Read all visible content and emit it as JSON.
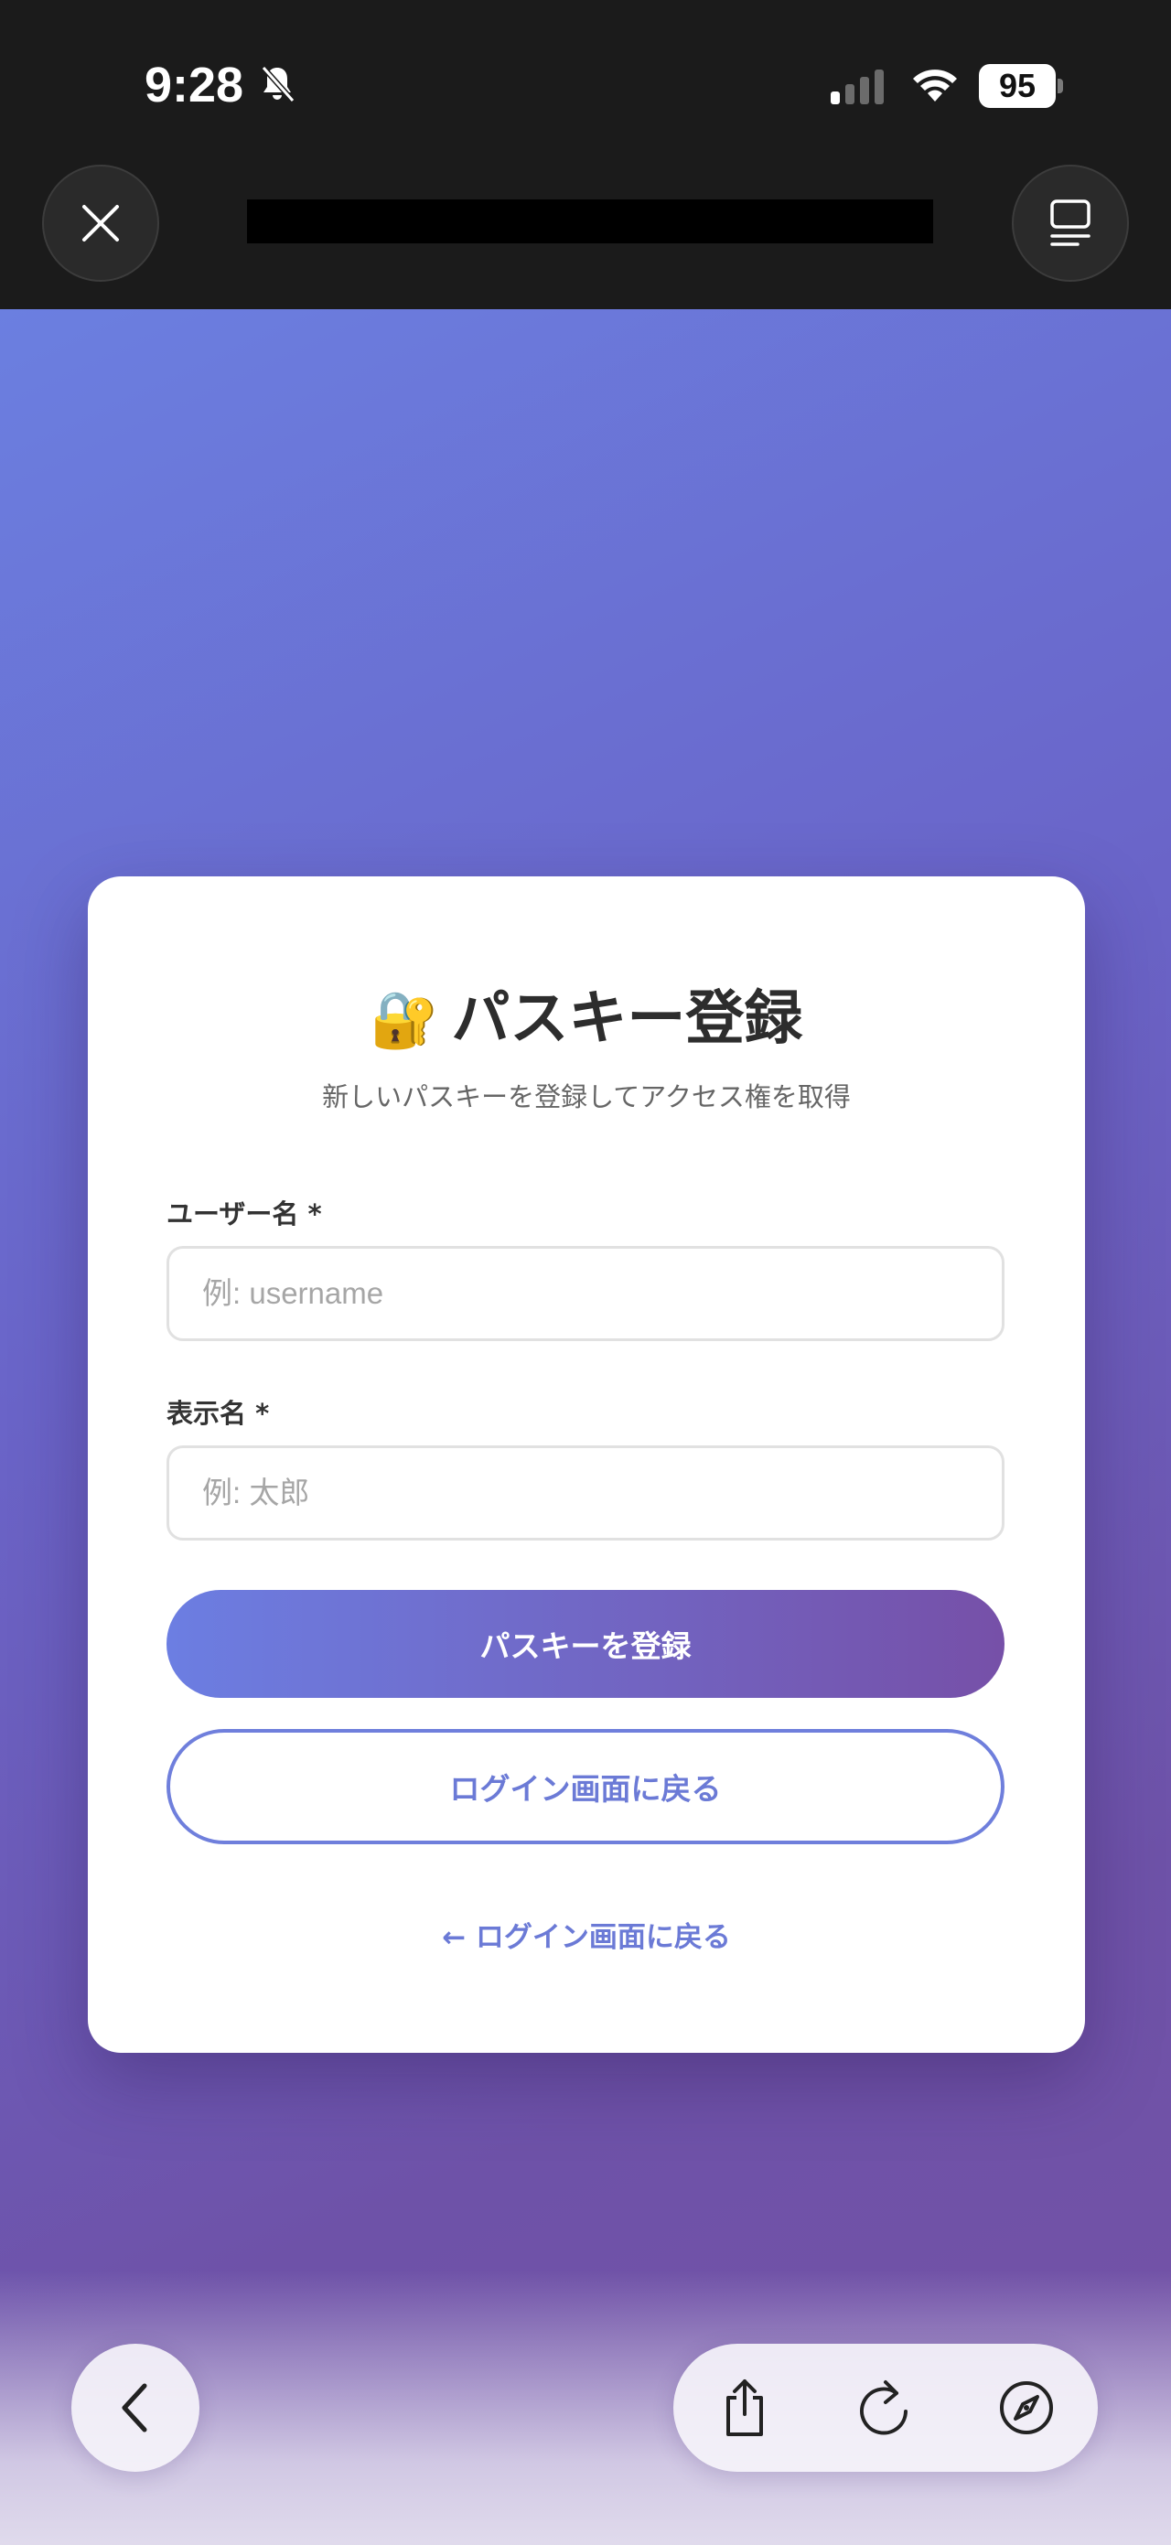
{
  "status_bar": {
    "time": "9:28",
    "battery": "95",
    "icons": [
      "bell-slash-icon",
      "cellular-signal-icon",
      "wifi-icon",
      "battery-icon"
    ]
  },
  "browser": {
    "close_icon": "close-icon",
    "menu_icon": "tab-overview-icon",
    "url_redacted": true
  },
  "card": {
    "emoji": "🔐",
    "title": "パスキー登録",
    "subtitle": "新しいパスキーを登録してアクセス権を取得",
    "username": {
      "label": "ユーザー名 *",
      "placeholder": "例: username",
      "value": ""
    },
    "display_name": {
      "label": "表示名 *",
      "placeholder": "例: 太郎",
      "value": ""
    },
    "register_button": "パスキーを登録",
    "back_button": "ログイン画面に戻る",
    "back_link": "← ログイン画面に戻る"
  },
  "toolbar": {
    "icons": [
      "back-chevron-icon",
      "share-icon",
      "reload-icon",
      "compass-icon"
    ]
  },
  "colors": {
    "accent": "#6b7ad6",
    "gradient_start": "#6c7ee2",
    "gradient_end": "#7650a8"
  }
}
